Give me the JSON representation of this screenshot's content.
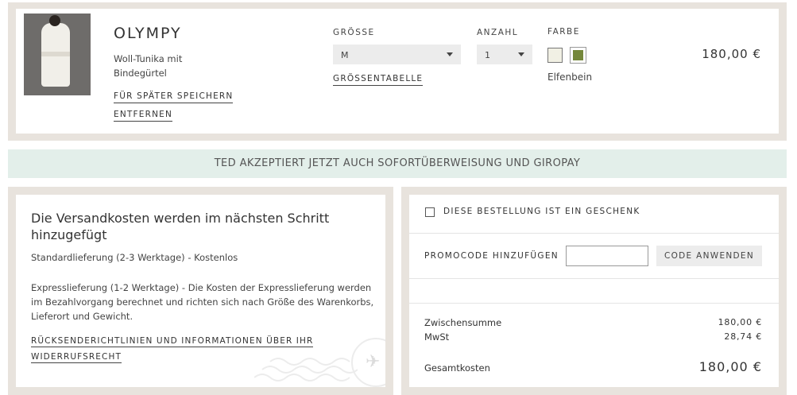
{
  "cart_item": {
    "brand": "OLYMPY",
    "product_name": "Woll-Tunika mit Bindegürtel",
    "save_for_later": "FÜR SPÄTER SPEICHERN",
    "remove": "ENTFERNEN",
    "size_label": "GRÖSSE",
    "size_value": "M",
    "size_chart": "GRÖSSENTABELLE",
    "quantity_label": "ANZAHL",
    "quantity_value": "1",
    "color_label": "FARBE",
    "color_name": "Elfenbein",
    "swatches": [
      "#f1f0e4",
      "#74873a"
    ],
    "price": "180,00 €"
  },
  "banner": {
    "text": "TED AKZEPTIERT JETZT AUCH SOFORTÜBERWEISUNG UND GIROPAY"
  },
  "shipping": {
    "title": "Die Versandkosten werden im nächsten Schritt hinzugefügt",
    "standard": "Standardlieferung (2-3 Werktage) - Kostenlos",
    "express": "Expresslieferung (1-2 Werktage) - Die Kosten der Expresslieferung werden im Bezahlvorgang berechnet und richten sich nach Größe des Warenkorbs, Lieferort und Gewicht.",
    "returns_link": "RÜCKSENDERICHTLINIEN UND INFORMATIONEN ÜBER IHR WIDERRUFSRECHT"
  },
  "summary": {
    "gift_label": "DIESE BESTELLUNG IST EIN GESCHENK",
    "promo_label": "PROMOCODE HINZUFÜGEN",
    "promo_value": "",
    "apply_button": "CODE ANWENDEN",
    "subtotal_label": "Zwischensumme",
    "subtotal_value": "180,00 €",
    "tax_label": "MwSt",
    "tax_value": "28,74 €",
    "total_label": "Gesamtkosten",
    "total_value": "180,00 €"
  },
  "colors": {
    "panel_border": "#e8e3dd",
    "banner_bg": "#e3efea",
    "select_bg": "#ececec"
  }
}
